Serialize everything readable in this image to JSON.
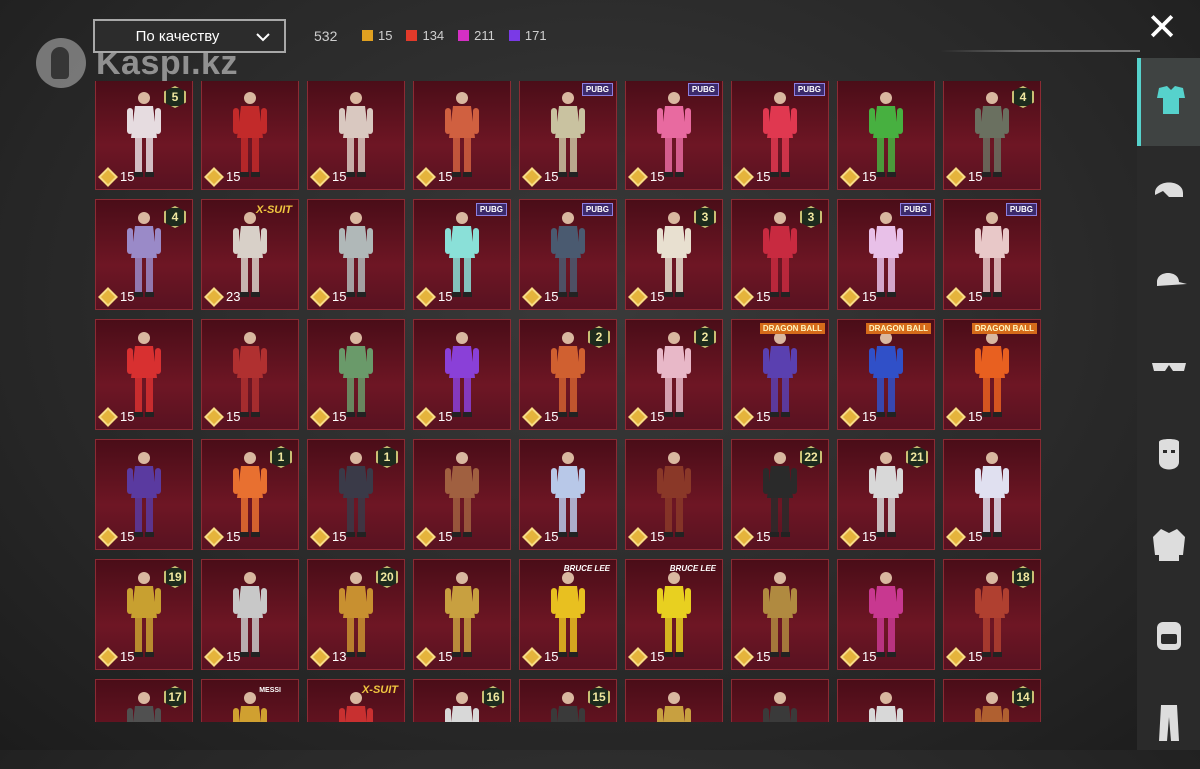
{
  "watermark": {
    "text": "Kaspi.kz"
  },
  "sort": {
    "label": "По качеству"
  },
  "summary": {
    "total": "532",
    "qualities": [
      {
        "color": "#e0a020",
        "count": "15"
      },
      {
        "color": "#e23a2a",
        "count": "134"
      },
      {
        "color": "#d52fc4",
        "count": "211"
      },
      {
        "color": "#7a3ae6",
        "count": "171"
      }
    ]
  },
  "close": {
    "symbol": "✕"
  },
  "items": [
    {
      "price": "15",
      "badge": "5",
      "tag": "",
      "outfit": "#e6dce0"
    },
    {
      "price": "15",
      "badge": "",
      "tag": "",
      "outfit": "#c22a2a"
    },
    {
      "price": "15",
      "badge": "",
      "tag": "",
      "outfit": "#d9c8c0"
    },
    {
      "price": "15",
      "badge": "",
      "tag": "",
      "outfit": "#d06040"
    },
    {
      "price": "15",
      "badge": "",
      "tag": "PUBG",
      "outfit": "#c9c2a0"
    },
    {
      "price": "15",
      "badge": "",
      "tag": "PUBG",
      "outfit": "#e86aa0"
    },
    {
      "price": "15",
      "badge": "",
      "tag": "PUBG",
      "outfit": "#e03850"
    },
    {
      "price": "15",
      "badge": "",
      "tag": "",
      "outfit": "#47b040"
    },
    {
      "price": "15",
      "badge": "4",
      "tag": "",
      "outfit": "#6a7060"
    },
    {
      "price": "15",
      "badge": "4",
      "tag": "",
      "outfit": "#9a8ac8"
    },
    {
      "price": "23",
      "badge": "",
      "tag": "X-SUIT",
      "outfit": "#d8d0c8"
    },
    {
      "price": "15",
      "badge": "",
      "tag": "",
      "outfit": "#b0b8b8"
    },
    {
      "price": "15",
      "badge": "",
      "tag": "PUBG",
      "outfit": "#8ae0d8"
    },
    {
      "price": "15",
      "badge": "",
      "tag": "PUBG",
      "outfit": "#4a5a70"
    },
    {
      "price": "15",
      "badge": "3",
      "tag": "",
      "outfit": "#e8e0d0"
    },
    {
      "price": "15",
      "badge": "3",
      "tag": "",
      "outfit": "#c82a40"
    },
    {
      "price": "15",
      "badge": "",
      "tag": "PUBG",
      "outfit": "#e8c0e8"
    },
    {
      "price": "15",
      "badge": "",
      "tag": "PUBG",
      "outfit": "#e8c8c8"
    },
    {
      "price": "15",
      "badge": "",
      "tag": "",
      "outfit": "#d83030"
    },
    {
      "price": "15",
      "badge": "",
      "tag": "",
      "outfit": "#b03030"
    },
    {
      "price": "15",
      "badge": "",
      "tag": "",
      "outfit": "#6a9a6a"
    },
    {
      "price": "15",
      "badge": "",
      "tag": "",
      "outfit": "#8a40d8"
    },
    {
      "price": "15",
      "badge": "2",
      "tag": "",
      "outfit": "#d06030"
    },
    {
      "price": "15",
      "badge": "2",
      "tag": "",
      "outfit": "#e8b8c8"
    },
    {
      "price": "15",
      "badge": "",
      "tag": "DRAGON BALL",
      "outfit": "#5a40b0"
    },
    {
      "price": "15",
      "badge": "",
      "tag": "DRAGON BALL",
      "outfit": "#3050c8"
    },
    {
      "price": "15",
      "badge": "",
      "tag": "DRAGON BALL",
      "outfit": "#e86020"
    },
    {
      "price": "15",
      "badge": "",
      "tag": "",
      "outfit": "#5a3aa0"
    },
    {
      "price": "15",
      "badge": "1",
      "tag": "",
      "outfit": "#e87030"
    },
    {
      "price": "15",
      "badge": "1",
      "tag": "",
      "outfit": "#3a3a48"
    },
    {
      "price": "15",
      "badge": "",
      "tag": "",
      "outfit": "#a06040"
    },
    {
      "price": "15",
      "badge": "",
      "tag": "",
      "outfit": "#b8c8e8"
    },
    {
      "price": "15",
      "badge": "",
      "tag": "",
      "outfit": "#8a3828"
    },
    {
      "price": "15",
      "badge": "22",
      "tag": "",
      "outfit": "#2a2a2a"
    },
    {
      "price": "15",
      "badge": "21",
      "tag": "",
      "outfit": "#d8d8d8"
    },
    {
      "price": "15",
      "badge": "",
      "tag": "",
      "outfit": "#e0e0f0"
    },
    {
      "price": "15",
      "badge": "19",
      "tag": "",
      "outfit": "#c8a030"
    },
    {
      "price": "15",
      "badge": "",
      "tag": "",
      "outfit": "#c8c8c8"
    },
    {
      "price": "13",
      "badge": "20",
      "tag": "",
      "outfit": "#c89030"
    },
    {
      "price": "15",
      "badge": "",
      "tag": "",
      "outfit": "#c8a040"
    },
    {
      "price": "15",
      "badge": "",
      "tag": "BRUCE LEE",
      "outfit": "#e8c020"
    },
    {
      "price": "15",
      "badge": "",
      "tag": "BRUCE LEE",
      "outfit": "#e8d020"
    },
    {
      "price": "15",
      "badge": "",
      "tag": "",
      "outfit": "#b08a40"
    },
    {
      "price": "15",
      "badge": "",
      "tag": "",
      "outfit": "#c83890"
    },
    {
      "price": "15",
      "badge": "18",
      "tag": "",
      "outfit": "#b04030"
    },
    {
      "price": "",
      "badge": "17",
      "tag": "",
      "outfit": "#505050"
    },
    {
      "price": "",
      "badge": "",
      "tag": "MESSI",
      "outfit": "#d0a030"
    },
    {
      "price": "",
      "badge": "",
      "tag": "X-SUIT",
      "outfit": "#c83030"
    },
    {
      "price": "",
      "badge": "16",
      "tag": "",
      "outfit": "#d8d8d8"
    },
    {
      "price": "",
      "badge": "15",
      "tag": "",
      "outfit": "#3a3a3a"
    },
    {
      "price": "",
      "badge": "",
      "tag": "",
      "outfit": "#c8a040"
    },
    {
      "price": "",
      "badge": "",
      "tag": "",
      "outfit": "#3a3a3a"
    },
    {
      "price": "",
      "badge": "",
      "tag": "",
      "outfit": "#d8d8d8"
    },
    {
      "price": "",
      "badge": "14",
      "tag": "",
      "outfit": "#b06030"
    }
  ],
  "sidebar": {
    "items": [
      {
        "icon": "outfit-icon",
        "active": true
      },
      {
        "icon": "helmet-icon",
        "active": false
      },
      {
        "icon": "cap-icon",
        "active": false
      },
      {
        "icon": "glasses-icon",
        "active": false
      },
      {
        "icon": "mask-icon",
        "active": false
      },
      {
        "icon": "jacket-icon",
        "active": false
      },
      {
        "icon": "backpack-icon",
        "active": false
      },
      {
        "icon": "pants-icon",
        "active": false
      }
    ]
  }
}
